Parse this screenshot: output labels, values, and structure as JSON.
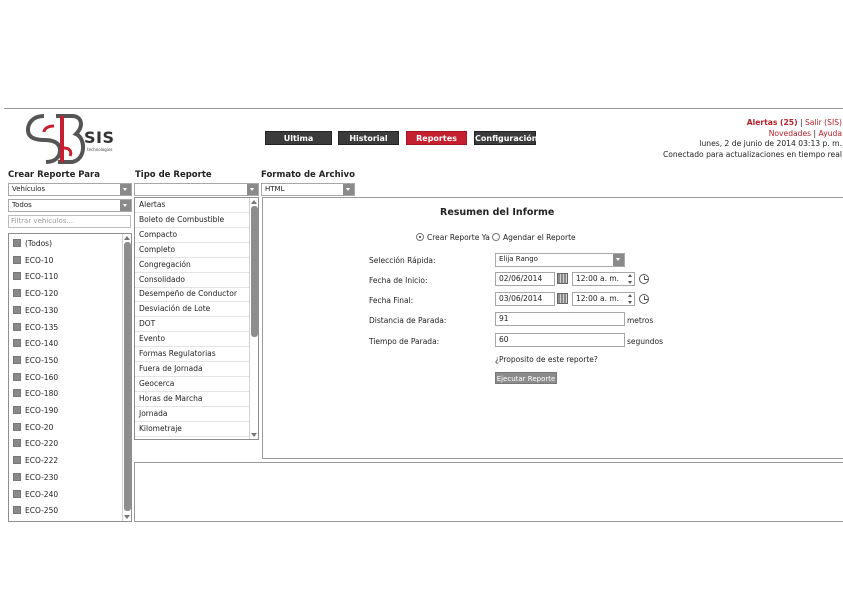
{
  "logo": {
    "text": "SIS",
    "subtitle": "technologies"
  },
  "nav": {
    "items": [
      {
        "label": "Ultima Posición",
        "active": false
      },
      {
        "label": "Historial",
        "active": false
      },
      {
        "label": "Reportes",
        "active": true
      },
      {
        "label": "Configuración",
        "active": false
      }
    ]
  },
  "topright": {
    "alerts": "Alertas (25)",
    "sep1": "|",
    "logout": "Salir (SIS)",
    "news": "Novedades",
    "sep2": "|",
    "help": "Ayuda",
    "date": "lunes, 2 de junio de 2014 03:13 p. m.",
    "status": "Conectado para actualizaciones en tiempo real"
  },
  "columns": {
    "create_for": "Crear Reporte Para",
    "report_type": "Tipo de Reporte",
    "file_format": "Formato de Archivo"
  },
  "selects": {
    "entity": "Vehículos",
    "group": "Todos",
    "report_type": "",
    "file_format": "HTML"
  },
  "filter": {
    "placeholder": "Filtrar vehiculos..."
  },
  "vehicles": [
    "(Todos)",
    "ECO-10",
    "ECO-110",
    "ECO-120",
    "ECO-130",
    "ECO-135",
    "ECO-140",
    "ECO-150",
    "ECO-160",
    "ECO-180",
    "ECO-190",
    "ECO-20",
    "ECO-220",
    "ECO-222",
    "ECO-230",
    "ECO-240",
    "ECO-250"
  ],
  "report_types": [
    "Alertas",
    "Boleto de Combustible",
    "Compacto",
    "Completo",
    "Congregación",
    "Consolidado",
    "Desempeño de Conductor",
    "Desviación de Lote",
    "DOT",
    "Evento",
    "Formas Regulatorias",
    "Fuera de Jornada",
    "Geocerca",
    "Horas de Marcha",
    "Jornada",
    "Kilometraje"
  ],
  "form": {
    "title": "Resumen del Informe",
    "radio_now": "Crear Reporte Ya",
    "radio_schedule": "Agendar el Reporte",
    "quick_label": "Selección Rápida:",
    "quick_value": "Elija Rango",
    "start_label": "Fecha de Inicio:",
    "start_date": "02/06/2014",
    "start_time": "12:00 a. m.",
    "end_label": "Fecha Final:",
    "end_date": "03/06/2014",
    "end_time": "12:00 a. m.",
    "stop_dist_label": "Distancia de Parada:",
    "stop_dist_value": "91",
    "stop_dist_unit": "metros",
    "stop_time_label": "Tiempo de Parada:",
    "stop_time_value": "60",
    "stop_time_unit": "segundos",
    "purpose_link": "¿Proposito de este reporte?",
    "run_button": "Ejecutar Reporte"
  },
  "colors": {
    "accent_red": "#c5202f",
    "nav_dark": "#3b3b3b",
    "link_red": "#b3202a"
  }
}
